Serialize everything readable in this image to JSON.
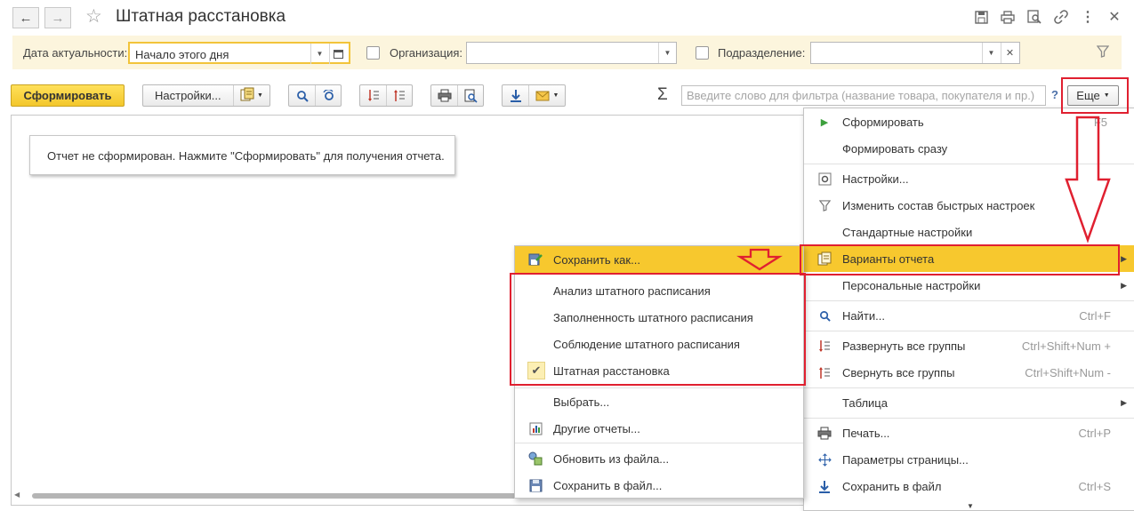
{
  "window": {
    "title": "Штатная расстановка",
    "back_icon": "←",
    "forward_icon": "→"
  },
  "filters": {
    "date_label": "Дата актуальности:",
    "date_value": "Начало этого дня",
    "org_label": "Организация:",
    "org_value": "",
    "dept_label": "Подразделение:",
    "dept_value": ""
  },
  "toolbar": {
    "generate_label": "Сформировать",
    "settings_label": "Настройки...",
    "search_placeholder": "Введите слово для фильтра (название товара, покупателя и пр.)",
    "help_label": "?",
    "more_label": "Еще",
    "sigma": "Σ"
  },
  "report": {
    "message": "Отчет не сформирован. Нажмите \"Сформировать\" для получения отчета."
  },
  "more_menu": {
    "items": [
      {
        "label": "Сформировать",
        "shortcut": "F5"
      },
      {
        "label": "Формировать сразу",
        "shortcut": ""
      },
      {
        "label": "Настройки...",
        "shortcut": ""
      },
      {
        "label": "Изменить состав быстрых настроек",
        "shortcut": ""
      },
      {
        "label": "Стандартные настройки",
        "shortcut": ""
      },
      {
        "label": "Варианты отчета",
        "shortcut": ""
      },
      {
        "label": "Персональные настройки",
        "shortcut": ""
      },
      {
        "label": "Найти...",
        "shortcut": "Ctrl+F"
      },
      {
        "label": "Развернуть все группы",
        "shortcut": "Ctrl+Shift+Num +"
      },
      {
        "label": "Свернуть все группы",
        "shortcut": "Ctrl+Shift+Num -"
      },
      {
        "label": "Таблица",
        "shortcut": ""
      },
      {
        "label": "Печать...",
        "shortcut": "Ctrl+P"
      },
      {
        "label": "Параметры страницы...",
        "shortcut": ""
      },
      {
        "label": "Сохранить в файл",
        "shortcut": "Ctrl+S"
      }
    ]
  },
  "variants_menu": {
    "items": [
      {
        "label": "Сохранить как..."
      },
      {
        "label": "Анализ штатного расписания"
      },
      {
        "label": "Заполненность штатного расписания"
      },
      {
        "label": "Соблюдение штатного расписания"
      },
      {
        "label": "Штатная расстановка"
      },
      {
        "label": "Выбрать..."
      },
      {
        "label": "Другие отчеты..."
      },
      {
        "label": "Обновить из файла..."
      },
      {
        "label": "Сохранить в файл..."
      }
    ]
  },
  "colors": {
    "highlight": "#f7c82e",
    "annotation_red": "#e02030",
    "filter_bg": "#fcf5dd",
    "primary_button": "#f3c72c"
  }
}
